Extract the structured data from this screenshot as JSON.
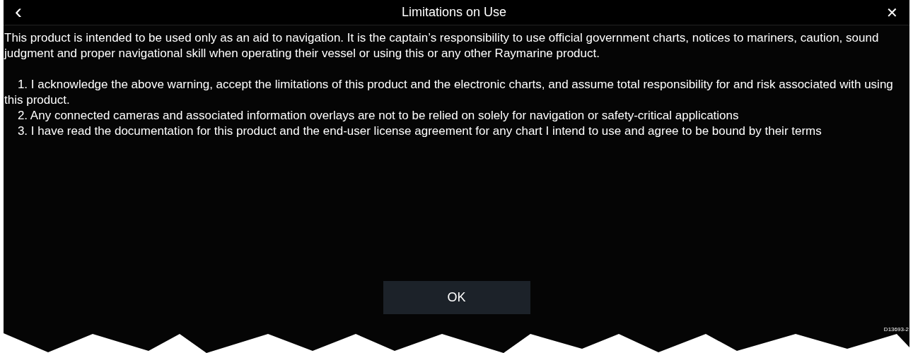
{
  "header": {
    "back_icon": "‹",
    "title": "Limitations on Use",
    "close_icon": "✕"
  },
  "intro": "This product is intended to be used only as an aid to navigation. It is the captain’s responsibility to use official government charts, notices to mariners, caution, sound judgment and proper navigational skill when operating their vessel or using this or any other Raymarine product.",
  "items": [
    {
      "number": "1.",
      "text": "I acknowledge the above warning, accept the limitations of this product and the electronic charts, and assume total responsibility for and risk associated with using this product."
    },
    {
      "number": "2.",
      "text": "Any connected cameras and associated information overlays are not to be relied on solely for navigation or safety-critical applications"
    },
    {
      "number": "3.",
      "text": "I have read the documentation for this product and the end-user license agreement for any chart I intend to use and agree to be bound by their terms"
    }
  ],
  "button": "OK",
  "figure_code": "D13693-2"
}
